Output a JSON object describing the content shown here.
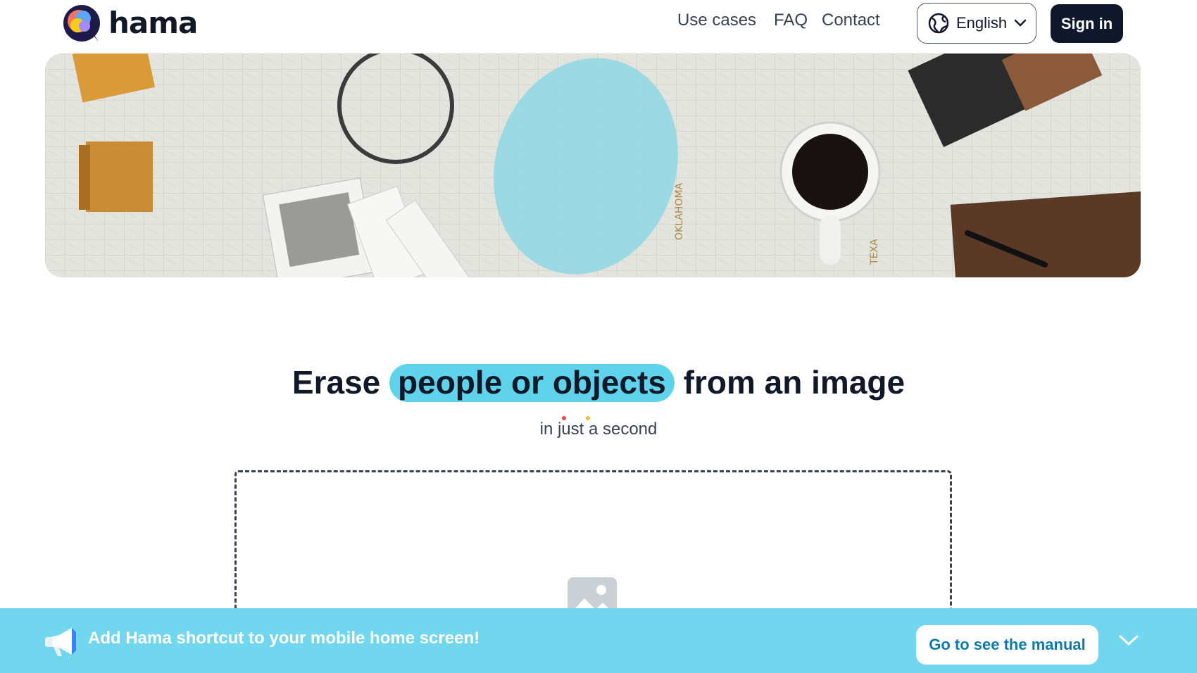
{
  "header": {
    "brand": "hama",
    "nav": [
      "Use cases",
      "FAQ",
      "Contact"
    ],
    "language": "English",
    "sign_in": "Sign in"
  },
  "hero": {
    "title_before": "Erase",
    "title_highlight": "people or objects",
    "title_after": "from an image",
    "subtitle": "in just a second"
  },
  "upload": {
    "placeholder_icon": "image-icon"
  },
  "promo": {
    "message": "Add Hama shortcut to your mobile home screen!",
    "button": "Go to see the manual"
  },
  "colors": {
    "accent": "#5fd3ec",
    "promo_bar": "#72d6ee",
    "sign_in_bg": "#0f172a",
    "manual_text": "#0e7aa8"
  }
}
